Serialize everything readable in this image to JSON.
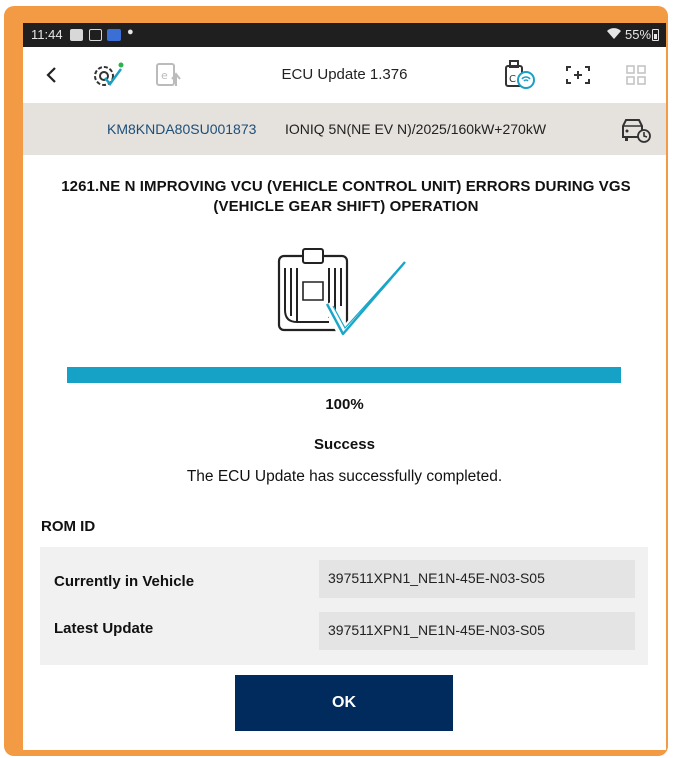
{
  "status_bar": {
    "time": "11:44",
    "battery": "55%"
  },
  "app_bar": {
    "title": "ECU Update 1.376",
    "icons": [
      "back-arrow-icon",
      "gear-check-icon",
      "e-upload-icon",
      "vci-wireless-icon",
      "scan-bracket-icon",
      "grid-icon"
    ]
  },
  "vehicle": {
    "vin": "KM8KNDA80SU001873",
    "description": "IONIQ 5N(NE EV N)/2025/160kW+270kW"
  },
  "update": {
    "heading": "1261.NE N IMPROVING VCU (VEHICLE CONTROL UNIT) ERRORS DURING VGS (VEHICLE GEAR SHIFT) OPERATION",
    "progress": 1.0,
    "progress_label": "100%",
    "status_title": "Success",
    "status_message": "The ECU Update has successfully completed."
  },
  "rom": {
    "label": "ROM ID",
    "rows": [
      {
        "label": "Currently in Vehicle",
        "value": "397511XPN1_NE1N-45E-N03-S05"
      },
      {
        "label": "Latest Update",
        "value": "397511XPN1_NE1N-45E-N03-S05"
      }
    ]
  },
  "ok_label": "OK",
  "colors": {
    "accent": "#16a2c6",
    "primary_button": "#002b5c",
    "vehicle_bar": "#e5e1dd",
    "frame": "#f39a45"
  }
}
